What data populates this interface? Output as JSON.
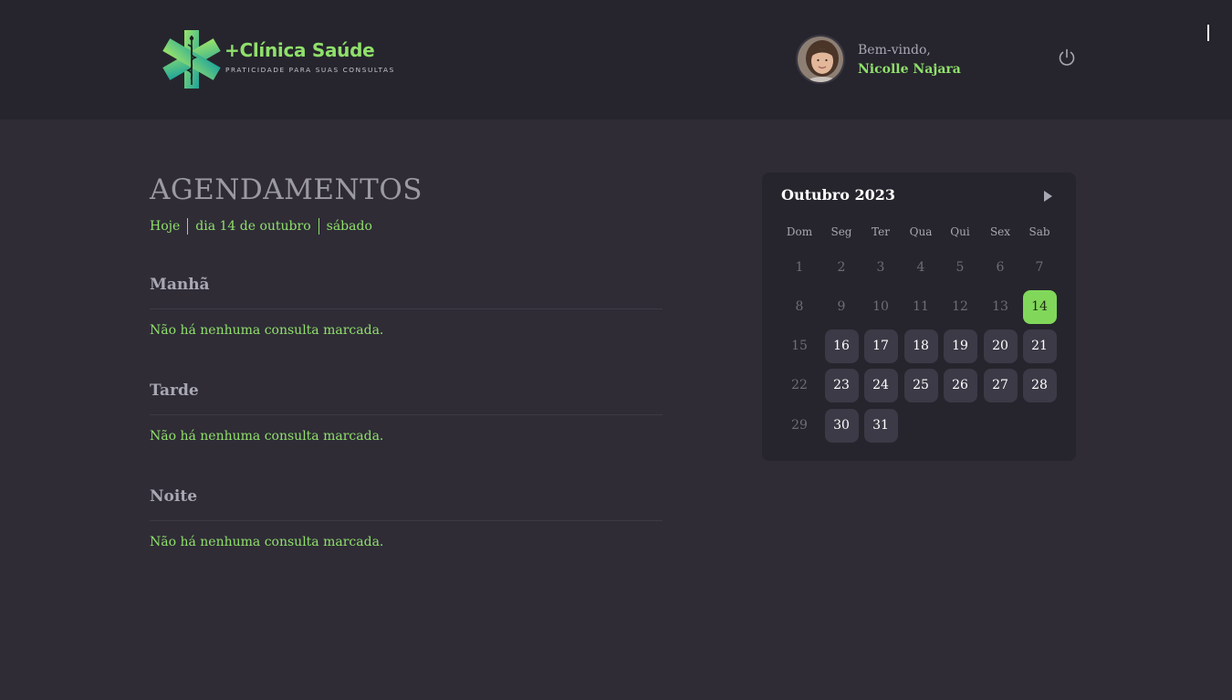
{
  "header": {
    "logo_title": "+Clínica Saúde",
    "logo_subtitle": "PRATICIDADE PARA SUAS CONSULTAS",
    "greeting": "Bem-vindo,",
    "user_name": "Nicolle Najara",
    "icons": {
      "logo": "caduceus-icon",
      "logout": "power-icon"
    }
  },
  "main": {
    "title": "AGENDAMENTOS",
    "today_label": "Hoje",
    "date_label": "dia 14 de outubro",
    "weekday_label": "sábado",
    "periods": [
      {
        "title": "Manhã",
        "empty_text": "Não há nenhuma consulta marcada."
      },
      {
        "title": "Tarde",
        "empty_text": "Não há nenhuma consulta marcada."
      },
      {
        "title": "Noite",
        "empty_text": "Não há nenhuma consulta marcada."
      }
    ]
  },
  "calendar": {
    "month_label": "Outubro 2023",
    "weekdays": [
      "Dom",
      "Seg",
      "Ter",
      "Qua",
      "Qui",
      "Sex",
      "Sab"
    ],
    "selected_day": 14,
    "first_available_day": 16,
    "unavailable_weekday": "Dom",
    "days": [
      "1",
      "2",
      "3",
      "4",
      "5",
      "6",
      "7",
      "8",
      "9",
      "10",
      "11",
      "12",
      "13",
      "14",
      "15",
      "16",
      "17",
      "18",
      "19",
      "20",
      "21",
      "22",
      "23",
      "24",
      "25",
      "26",
      "27",
      "28",
      "29",
      "30",
      "31"
    ]
  },
  "colors": {
    "accent": "#81d75a",
    "background": "#2f2c36",
    "header_bg": "#26252d",
    "card_bg": "#26252d",
    "available_day_bg": "#3c3a46"
  }
}
